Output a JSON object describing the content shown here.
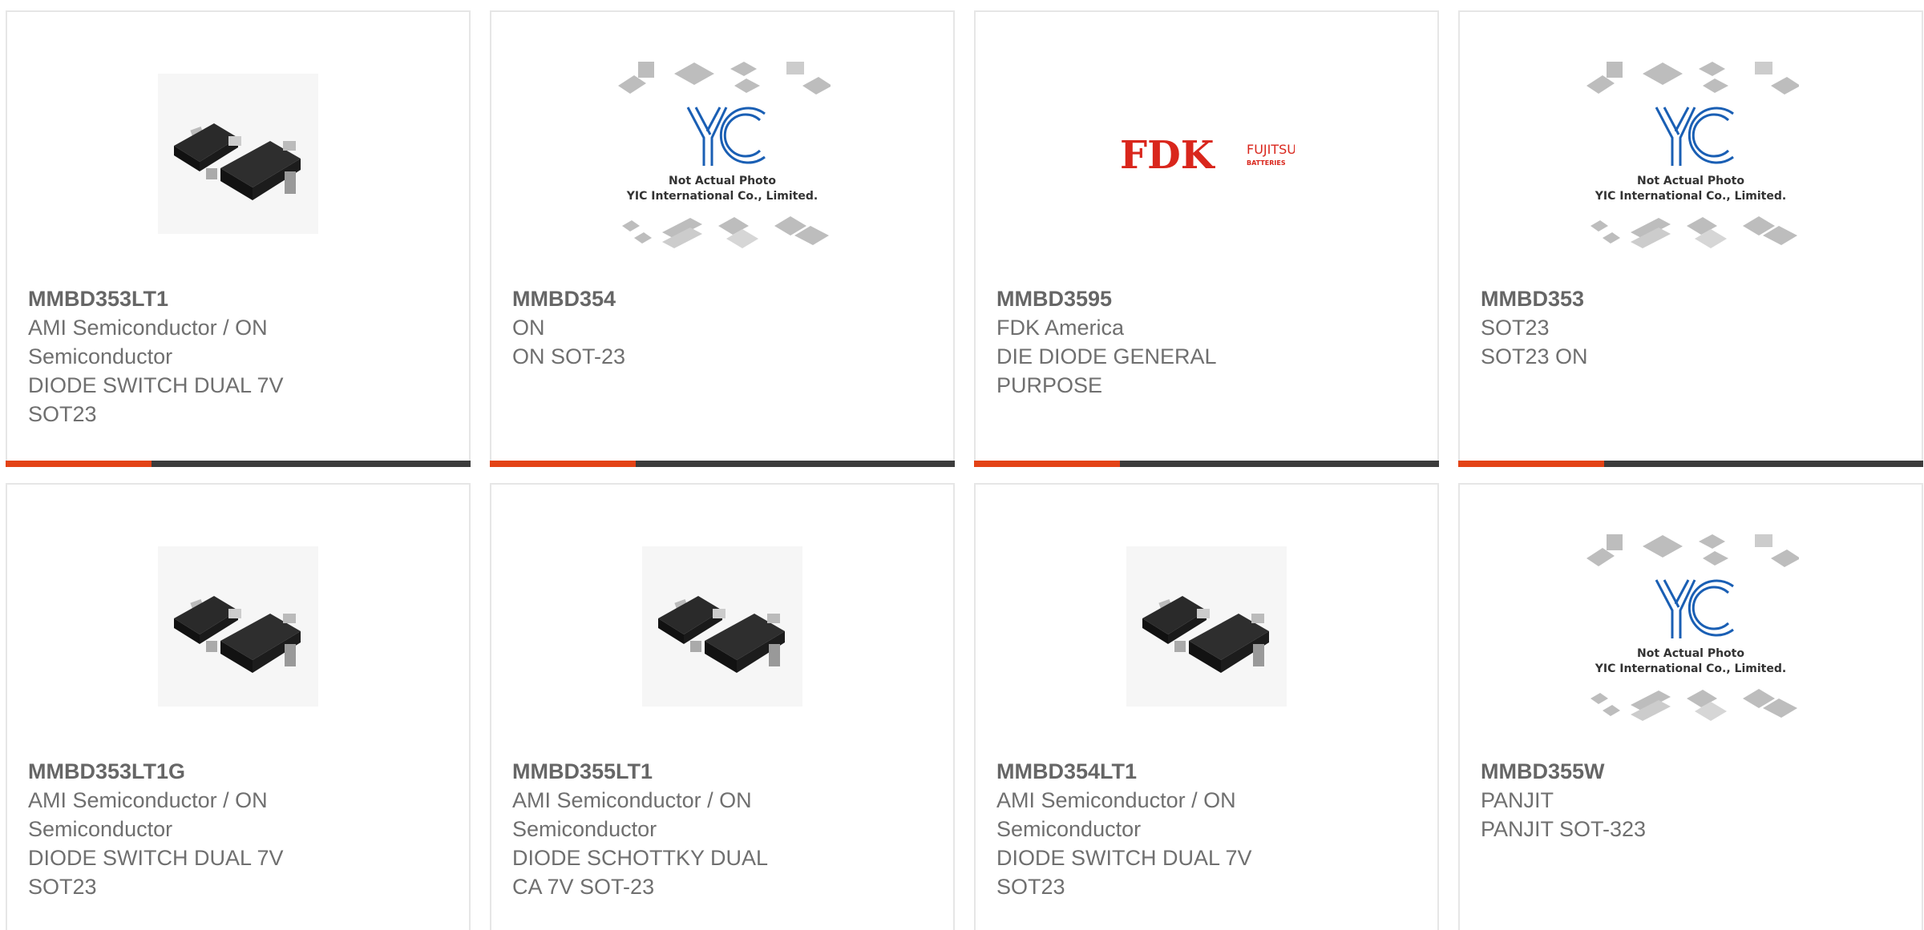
{
  "products": [
    {
      "part": "MMBD353LT1",
      "manufacturer": "AMI Semiconductor / ON Semiconductor",
      "description": "DIODE SWITCH DUAL 7V SOT23",
      "image": "sot23-photo"
    },
    {
      "part": "MMBD354",
      "manufacturer": "ON",
      "description": "ON SOT-23",
      "image": "yic-placeholder",
      "placeholder_line1": "Not Actual Photo",
      "placeholder_line2": "YIC International Co., Limited."
    },
    {
      "part": "MMBD3595",
      "manufacturer": "FDK America",
      "description": "DIE DIODE GENERAL PURPOSE",
      "image": "fdk-logo",
      "logo_main": "FDK",
      "logo_brand": "FUJITSU",
      "logo_sub": "BATTERIES"
    },
    {
      "part": "MMBD353",
      "manufacturer": "SOT23",
      "description": "SOT23 ON",
      "image": "yic-placeholder",
      "placeholder_line1": "Not Actual Photo",
      "placeholder_line2": "YIC International Co., Limited."
    },
    {
      "part": "MMBD353LT1G",
      "manufacturer": "AMI Semiconductor / ON Semiconductor",
      "description": "DIODE SWITCH DUAL 7V SOT23",
      "image": "sot23-photo"
    },
    {
      "part": "MMBD355LT1",
      "manufacturer": "AMI Semiconductor / ON Semiconductor",
      "description": "DIODE SCHOTTKY DUAL CA 7V SOT-23",
      "image": "sot23-photo"
    },
    {
      "part": "MMBD354LT1",
      "manufacturer": "AMI Semiconductor / ON Semiconductor",
      "description": "DIODE SWITCH DUAL 7V SOT23",
      "image": "sot23-photo"
    },
    {
      "part": "MMBD355W",
      "manufacturer": "PANJIT",
      "description": "PANJIT SOT-323",
      "image": "yic-placeholder",
      "placeholder_line1": "Not Actual Photo",
      "placeholder_line2": "YIC International Co., Limited."
    }
  ],
  "colors": {
    "accent": "#e34316",
    "bar": "#3c3c3c",
    "border": "#e6e6e6",
    "text": "#6f6f6f",
    "fdk_red": "#d9261c",
    "yic_blue": "#1a5fb4"
  }
}
